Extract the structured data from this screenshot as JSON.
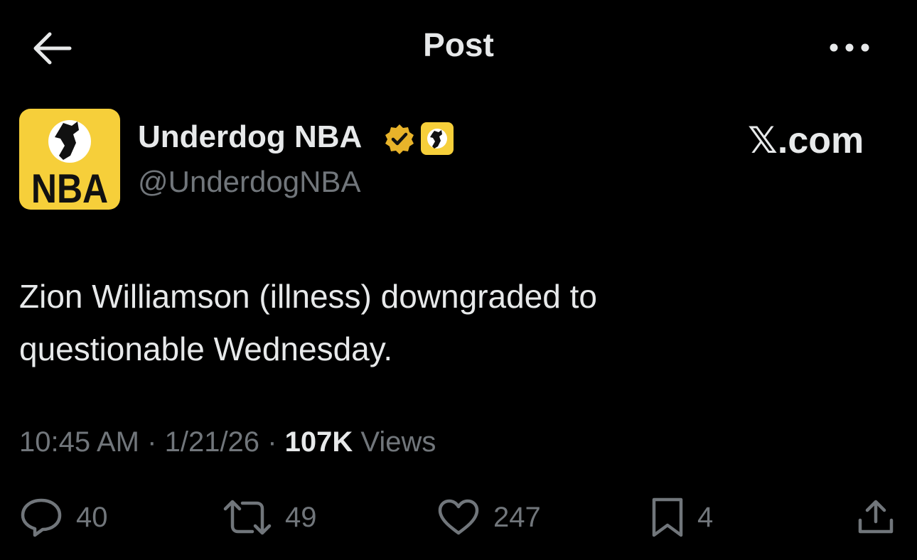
{
  "header": {
    "title": "Post",
    "back_icon": "arrow-left-icon",
    "more_icon": "more-horizontal-icon"
  },
  "author": {
    "name": "Underdog NBA",
    "handle": "@UnderdogNBA",
    "avatar_text": "NBA",
    "verified_badge_color": "#e8b32a",
    "avatar_color": "#f6cf3a"
  },
  "watermark": "𝕏.com",
  "post": {
    "text": "Zion Williamson (illness) downgraded to\nquestionable Wednesday."
  },
  "meta": {
    "time": "10:45 AM",
    "separator": "·",
    "date": "1/21/26",
    "views_count": "107K",
    "views_label": "Views"
  },
  "actions": {
    "replies": "40",
    "reposts": "49",
    "likes": "247",
    "bookmarks": "4"
  }
}
